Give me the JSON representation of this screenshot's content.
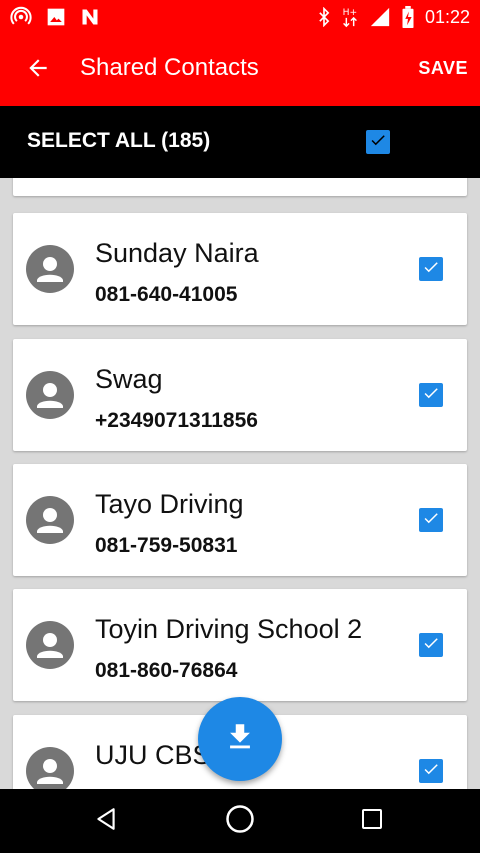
{
  "status_bar": {
    "time": "01:22",
    "left_icons": [
      "hotspot-icon",
      "image-icon",
      "n-notification-icon"
    ],
    "right_icons": [
      "bluetooth-icon",
      "network-hplus-icon",
      "signal-icon",
      "battery-icon"
    ]
  },
  "app_bar": {
    "title": "Shared Contacts",
    "save_label": "SAVE",
    "back_icon": "arrow-back-icon"
  },
  "select_bar": {
    "label": "SELECT ALL (185)",
    "checked": true
  },
  "contacts": [
    {
      "name": "",
      "phone": "",
      "checked": true
    },
    {
      "name": "Sunday Naira",
      "phone": "081-640-41005",
      "checked": true
    },
    {
      "name": "Swag",
      "phone": "+2349071311856",
      "checked": true
    },
    {
      "name": "Tayo Driving",
      "phone": "081-759-50831",
      "checked": true
    },
    {
      "name": "Toyin Driving School 2",
      "phone": "081-860-76864",
      "checked": true
    },
    {
      "name": "UJU CBS",
      "phone": "",
      "checked": true
    }
  ],
  "fab": {
    "icon": "download-icon"
  },
  "nav_bar": {
    "buttons": [
      "back-triangle-icon",
      "home-circle-icon",
      "recents-square-icon"
    ]
  },
  "colors": {
    "primary": "#ff0000",
    "accent": "#1e88e5",
    "dark": "#000000",
    "background": "#d9d9d9"
  }
}
